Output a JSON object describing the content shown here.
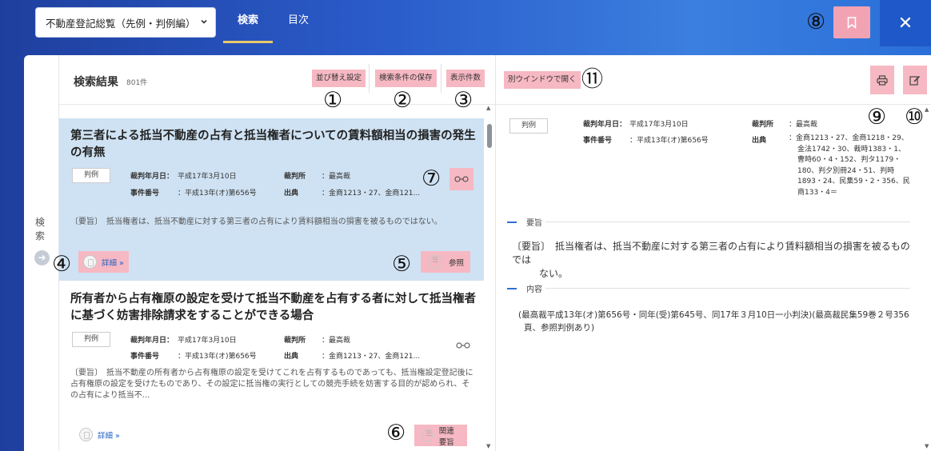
{
  "top_bar": {
    "book_select_value": "不動産登記総覧（先例・判例編）",
    "tabs": [
      {
        "label": "検索",
        "active": true
      },
      {
        "label": "目次",
        "active": false
      }
    ],
    "close_label": "✕"
  },
  "annotations": {
    "a1": "①",
    "a2": "②",
    "a3": "③",
    "a4": "④",
    "a5": "⑤",
    "a6": "⑥",
    "a7": "⑦",
    "a8": "⑧",
    "a9": "⑨",
    "a10": "⑩",
    "a11": "⑪"
  },
  "side": {
    "label": "検索"
  },
  "results": {
    "title": "検索結果",
    "count": "801件",
    "sort_button": "並び替え設定",
    "save_button": "検索条件の保存",
    "display_count_button": "表示件数",
    "items": [
      {
        "title": "第三者による抵当不動産の占有と抵当権者についての賃料額相当の損害の発生の有無",
        "tag": "判例",
        "date_label": "裁判年月日：",
        "date": "平成17年3月10日",
        "court_label": "裁判所",
        "court": "：最高裁",
        "case_label": "事件番号",
        "case_no": "：平成13年(オ)第656号",
        "source_label": "出典",
        "source": "：金商1213・27、金商121...",
        "summary": "〔要旨〕　抵当権者は、抵当不動産に対する第三者の占有により賃料額相当の損害を被るものではない。",
        "detail_link": "詳細 »",
        "ref_button": "参照",
        "selected": true
      },
      {
        "title": "所有者から占有権原の設定を受けて抵当不動産を占有する者に対して抵当権者に基づく妨害排除請求をすることができる場合",
        "tag": "判例",
        "date_label": "裁判年月日：",
        "date": "平成17年3月10日",
        "court_label": "裁判所",
        "court": "：最高裁",
        "case_label": "事件番号",
        "case_no": "：平成13年(オ)第656号",
        "source_label": "出典",
        "source": "：金商1213・27、金商121...",
        "summary": "〔要旨〕　抵当不動産の所有者から占有権原の設定を受けてこれを占有するものであっても、抵当権設定登記後に占有権原の設定を受けたものであり、その設定に抵当権の実行としての競売手続を妨害する目的が認められ、その占有により抵当不...",
        "detail_link": "詳細 »",
        "related_button": "関連要旨",
        "selected": false
      }
    ]
  },
  "detail": {
    "open_window_button": "別ウインドウで開く",
    "tag": "判例",
    "date_label": "裁判年月日：",
    "date": "平成17年3月10日",
    "court_label": "裁判所",
    "court": "：最高裁",
    "case_label": "事件番号",
    "case_no": "：平成13年(オ)第656号",
    "source_label": "出典",
    "source_lines": [
      "：金商1213・27、金商1218・29、",
      "金法1742・30、裁時1383・1、",
      "曹時60・4・152、判タ1179・",
      "180、判夕別冊24・51、判時",
      "1893・24、民集59・2・356、民",
      "商133・4＝"
    ],
    "summary_heading": "要旨",
    "summary_lines": [
      "〔要旨〕　抵当権者は、抵当不動産に対する第三者の占有により賃料額相当の損害を被るものでは",
      "ない。"
    ],
    "content_heading": "内容",
    "content_lines": [
      "(最高裁平成13年(オ)第656号・同年(受)第645号、同17年３月10日一小判決)(最高裁民集59巻２号356",
      "頁、参照判例あり)"
    ]
  },
  "colors": {
    "accent_highlight": "#f6b8c2",
    "selected_row": "#cfe2f3",
    "link_blue": "#1d5fbf",
    "header_gradient_start": "#1f3f9e",
    "header_gradient_end": "#3b7fe0"
  },
  "icons": {
    "bookmark": "bookmark-icon",
    "close": "close-icon",
    "print": "print-icon",
    "edit": "edit-icon",
    "glasses": "glasses-icon",
    "detail": "document-icon",
    "list": "list-icon",
    "arrow": "arrow-right-icon"
  }
}
